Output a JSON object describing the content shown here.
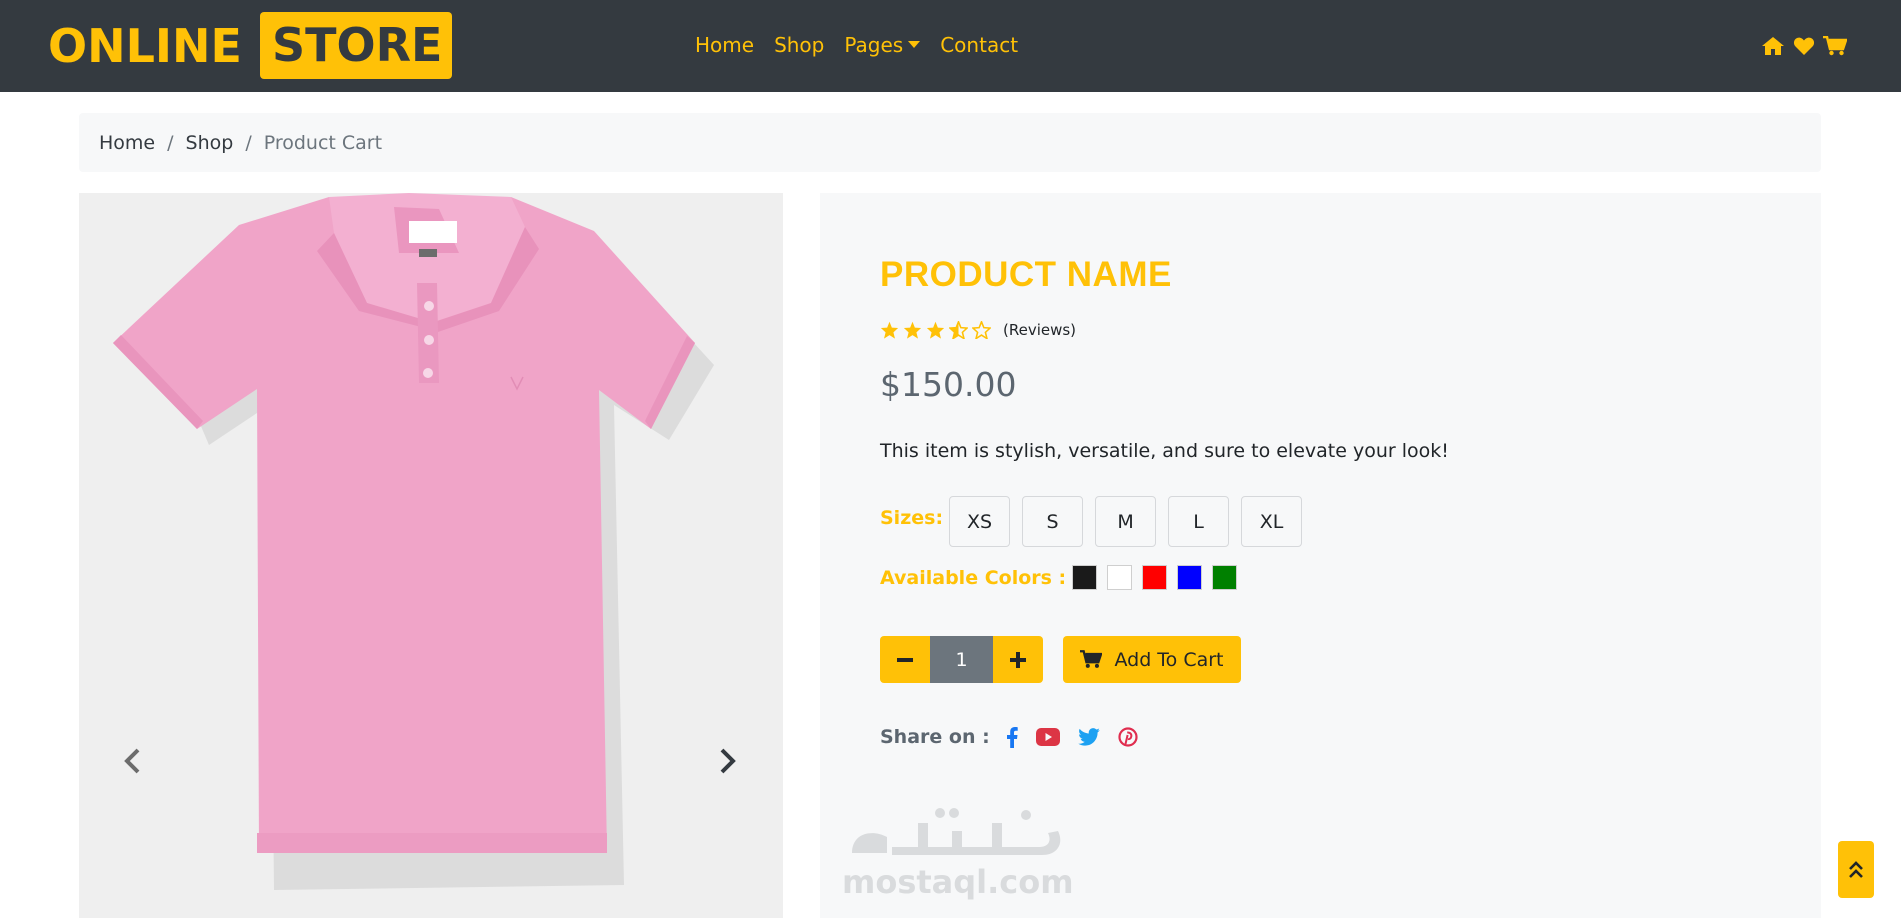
{
  "brand": {
    "part1": "ONLINE",
    "part2": "STORE"
  },
  "nav": {
    "links": [
      "Home",
      "Shop",
      "Pages",
      "Contact"
    ],
    "icons": [
      "home-icon",
      "heart-icon",
      "cart-icon"
    ]
  },
  "breadcrumb": {
    "items": [
      "Home",
      "Shop"
    ],
    "active": "Product Cart",
    "separator": "/"
  },
  "carousel": {
    "image": "pink-polo-shirt",
    "prev_icon": "chevron-left-icon",
    "next_icon": "chevron-right-icon"
  },
  "product": {
    "name": "PRODUCT NAME",
    "rating": 3.5,
    "rating_max": 5,
    "reviews_label": "(Reviews)",
    "price": "$150.00",
    "description": "This item is stylish, versatile, and sure to elevate your look!",
    "sizes_label": "Sizes:",
    "sizes": [
      "XS",
      "S",
      "M",
      "L",
      "XL"
    ],
    "colors_label": "Available Colors :",
    "colors": [
      "#1a1a1a",
      "#ffffff",
      "#ff0000",
      "#0000ff",
      "#008000"
    ],
    "quantity": "1",
    "add_to_cart_label": "Add To Cart",
    "share_label": "Share on :",
    "share_icons": [
      "facebook-icon",
      "youtube-icon",
      "twitter-icon",
      "pinterest-icon"
    ]
  },
  "watermark": {
    "arabic": "مستقل",
    "latin": "mostaql.com"
  },
  "theme": {
    "accent": "#ffc107",
    "navbar_bg": "#343a40",
    "panel_bg": "#f7f8f9",
    "facebook": "#1877f2",
    "youtube": "#dc3545",
    "twitter": "#1da1f2",
    "pinterest": "#e02d4f"
  }
}
